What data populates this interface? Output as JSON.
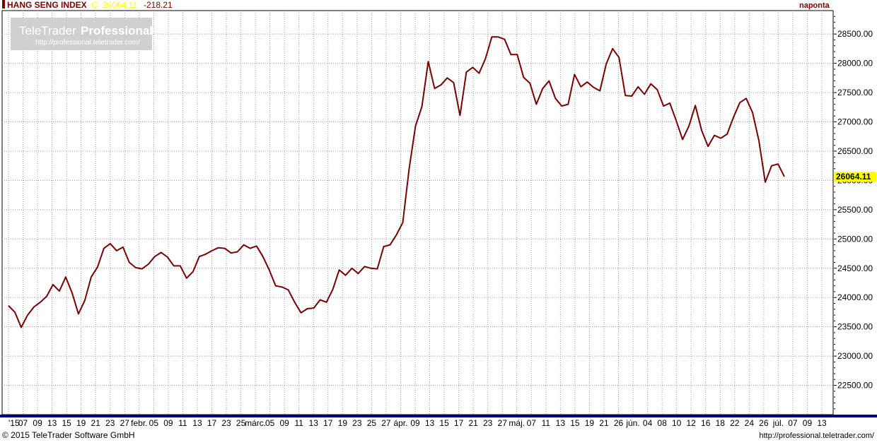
{
  "header": {
    "instrument": "HANG SENG INDEX",
    "close_label": "C:",
    "close_value": "26064.11",
    "change": "-218.21",
    "interval": "naponta"
  },
  "watermark": {
    "brand_light": "TeleTrader",
    "brand_bold": "Professional",
    "url": "http://professional.teletrader.com/"
  },
  "footer": {
    "copyright": "© 2015 TeleTrader Software GmbH",
    "url": "http://professional.teletrader.com/"
  },
  "colors": {
    "line": "#7f0000",
    "header_name": "#800000",
    "header_value": "#ffff00",
    "last_value_bg": "#ffff00",
    "axis_band": "#000080",
    "grid": "#9a9a9a"
  },
  "chart_data": {
    "type": "line",
    "title": "HANG SENG INDEX",
    "ylim": [
      22000,
      28900
    ],
    "y_ticks": [
      22500,
      23000,
      23500,
      24000,
      24500,
      25000,
      25500,
      26000,
      26500,
      27000,
      27500,
      28000,
      28500
    ],
    "y_tick_labels": [
      "22500.00",
      "23000.00",
      "23500.00",
      "24000.00",
      "24500.00",
      "25000.00",
      "25500.00",
      "26000.00",
      "26500.00",
      "27000.00",
      "27500.00",
      "28000.00",
      "28500.00"
    ],
    "last_value_label": "26064.11",
    "x_labels": [
      "'15",
      "07",
      "09",
      "13",
      "15",
      "19",
      "21",
      "23",
      "27",
      "febr.",
      "05",
      "09",
      "11",
      "13",
      "17",
      "23",
      "25",
      "márc.",
      "05",
      "09",
      "11",
      "13",
      "17",
      "19",
      "23",
      "25",
      "27",
      "ápr.",
      "09",
      "13",
      "15",
      "17",
      "21",
      "23",
      "27",
      "máj.",
      "07",
      "11",
      "13",
      "15",
      "19",
      "21",
      "26",
      "jún.",
      "04",
      "08",
      "10",
      "12",
      "16",
      "18",
      "22",
      "24",
      "26",
      "júl.",
      "07",
      "09",
      "13"
    ],
    "grid": true,
    "series": [
      {
        "values": [
          23860,
          23750,
          23490,
          23700,
          23840,
          23920,
          24020,
          24220,
          24110,
          24350,
          24080,
          23720,
          23950,
          24350,
          24520,
          24840,
          24920,
          24800,
          24860,
          24600,
          24510,
          24490,
          24570,
          24700,
          24770,
          24690,
          24540,
          24540,
          24330,
          24440,
          24700,
          24740,
          24800,
          24850,
          24840,
          24760,
          24780,
          24900,
          24840,
          24880,
          24700,
          24470,
          24200,
          24180,
          24130,
          23920,
          23740,
          23810,
          23820,
          23960,
          23920,
          24140,
          24470,
          24380,
          24500,
          24410,
          24530,
          24500,
          24490,
          24870,
          24900,
          25070,
          25280,
          26200,
          26930,
          27260,
          28030,
          27570,
          27630,
          27750,
          27670,
          27110,
          27850,
          27930,
          27830,
          28080,
          28450,
          28450,
          28410,
          28150,
          28150,
          27760,
          27660,
          27300,
          27570,
          27700,
          27400,
          27270,
          27300,
          27810,
          27600,
          27680,
          27590,
          27530,
          27990,
          28250,
          28100,
          27450,
          27440,
          27600,
          27470,
          27650,
          27550,
          27270,
          27320,
          27020,
          26700,
          26930,
          27280,
          26850,
          26580,
          26770,
          26720,
          26790,
          27080,
          27330,
          27400,
          27160,
          26680,
          25970,
          26250,
          26280,
          26064
        ]
      }
    ]
  }
}
